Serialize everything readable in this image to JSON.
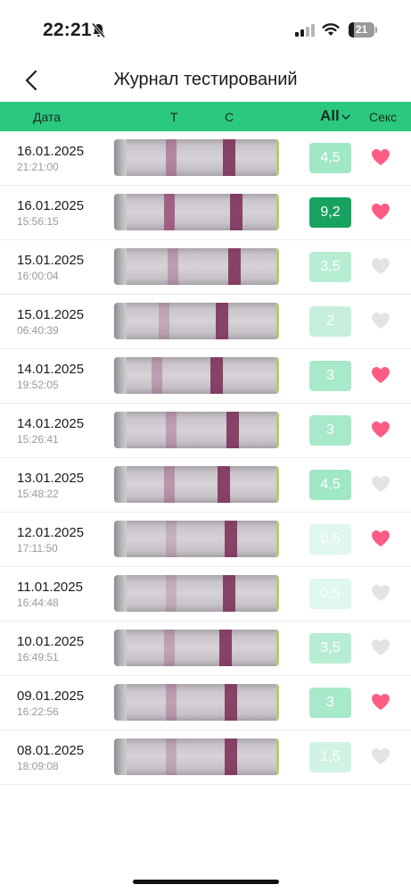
{
  "status": {
    "time": "22:21",
    "battery": "21",
    "battery_level": 0.21
  },
  "nav": {
    "title": "Журнал тестирований"
  },
  "header": {
    "date": "Дата",
    "t": "T",
    "c": "C",
    "filter": "All",
    "sex": "Секс"
  },
  "colors": {
    "accent": "#2bc97f",
    "heart_on": "#ff5c85",
    "heart_off": "#e3e3e3"
  },
  "rows": [
    {
      "date": "16.01.2025",
      "time": "21:21:00",
      "score": "4,5",
      "score_level": 0.5,
      "sex": true,
      "t_intensity": 0.55
    },
    {
      "date": "16.01.2025",
      "time": "15:56:15",
      "score": "9,2",
      "score_level": 1.0,
      "sex": true,
      "t_intensity": 0.95
    },
    {
      "date": "15.01.2025",
      "time": "16:00:04",
      "score": "3,5",
      "score_level": 0.35,
      "sex": false,
      "t_intensity": 0.3
    },
    {
      "date": "15.01.2025",
      "time": "06:40:39",
      "score": "2",
      "score_level": 0.25,
      "sex": false,
      "t_intensity": 0.2
    },
    {
      "date": "14.01.2025",
      "time": "19:52:05",
      "score": "3",
      "score_level": 0.45,
      "sex": true,
      "t_intensity": 0.3
    },
    {
      "date": "14.01.2025",
      "time": "15:26:41",
      "score": "3",
      "score_level": 0.45,
      "sex": true,
      "t_intensity": 0.3
    },
    {
      "date": "13.01.2025",
      "time": "15:48:22",
      "score": "4,5",
      "score_level": 0.5,
      "sex": false,
      "t_intensity": 0.4
    },
    {
      "date": "12.01.2025",
      "time": "17:11:50",
      "score": "0,5",
      "score_level": 0.08,
      "sex": true,
      "t_intensity": 0.12
    },
    {
      "date": "11.01.2025",
      "time": "16:44:48",
      "score": "0,5",
      "score_level": 0.08,
      "sex": false,
      "t_intensity": 0.1
    },
    {
      "date": "10.01.2025",
      "time": "16:49:51",
      "score": "3,5",
      "score_level": 0.35,
      "sex": false,
      "t_intensity": 0.25
    },
    {
      "date": "09.01.2025",
      "time": "16:22:56",
      "score": "3",
      "score_level": 0.45,
      "sex": true,
      "t_intensity": 0.3
    },
    {
      "date": "08.01.2025",
      "time": "18:09:08",
      "score": "1,5",
      "score_level": 0.18,
      "sex": false,
      "t_intensity": 0.18
    }
  ]
}
